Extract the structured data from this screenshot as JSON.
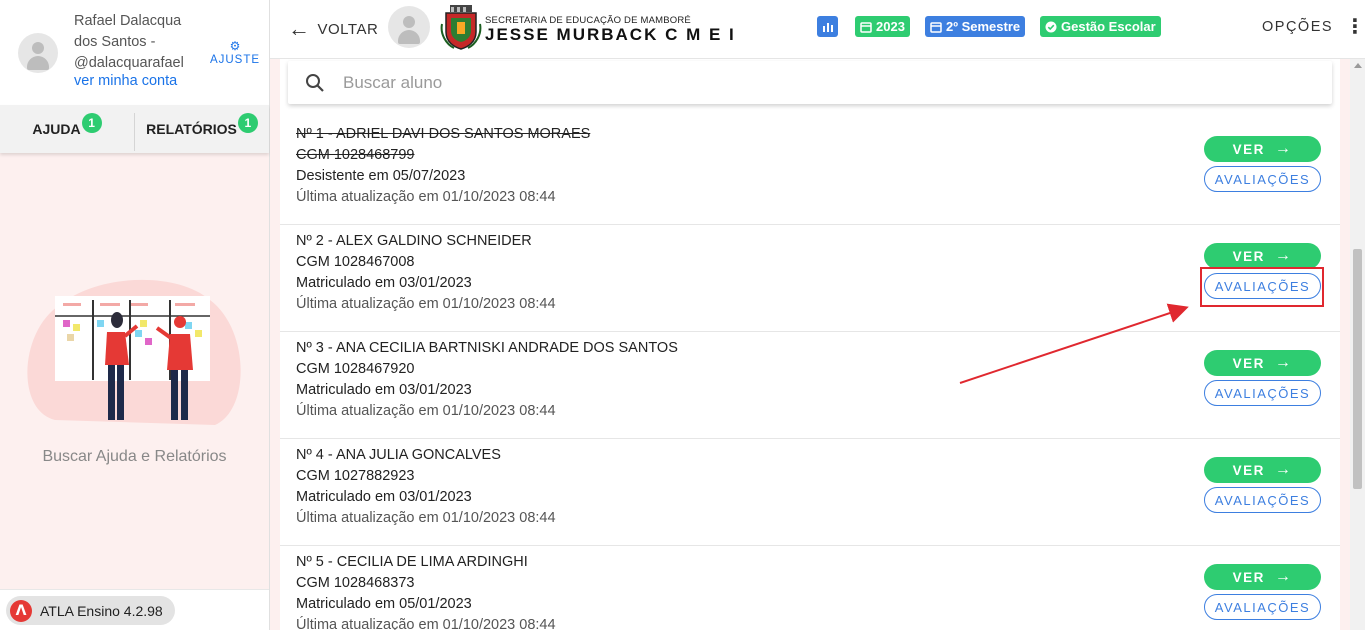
{
  "sidebar": {
    "user_name": "Rafael Dalacqua dos Santos - @dalacquarafael",
    "account_link": "ver minha conta",
    "adjust_label": "AJUSTE",
    "tabs": [
      {
        "label": "AJUDA",
        "badge": "1"
      },
      {
        "label": "RELATÓRIOS",
        "badge": "1"
      }
    ],
    "empty_text": "Buscar Ajuda e Relatórios",
    "version": "ATLA Ensino 4.2.98"
  },
  "header": {
    "back_label": "VOLTAR",
    "secretaria": "SECRETARIA DE EDUCAÇÃO DE MAMBORÉ",
    "school_name": "JESSE MURBACK C M E I",
    "pills": {
      "year": "2023",
      "semester": "2º Semestre",
      "gestao": "Gestão Escolar"
    },
    "options_label": "OPÇÕES",
    "colors": {
      "green": "#2ecc71",
      "blue": "#3d7fe0"
    }
  },
  "search": {
    "placeholder": "Buscar aluno",
    "value": ""
  },
  "students": [
    {
      "name": "Nº 1 - ADRIEL DAVI DOS SANTOS MORAES",
      "cgm": "CGM 1028468799",
      "status": "Desistente em 05/07/2023",
      "updated": "Última atualização em 01/10/2023 08:44",
      "struck": true
    },
    {
      "name": "Nº 2 - ALEX GALDINO SCHNEIDER",
      "cgm": "CGM 1028467008",
      "status": "Matriculado em 03/01/2023",
      "updated": "Última atualização em 01/10/2023 08:44",
      "struck": false,
      "highlighted": true
    },
    {
      "name": "Nº 3 - ANA CECILIA BARTNISKI ANDRADE DOS SANTOS",
      "cgm": "CGM 1028467920",
      "status": "Matriculado em 03/01/2023",
      "updated": "Última atualização em 01/10/2023 08:44",
      "struck": false
    },
    {
      "name": "Nº 4 - ANA JULIA GONCALVES",
      "cgm": "CGM 1027882923",
      "status": "Matriculado em 03/01/2023",
      "updated": "Última atualização em 01/10/2023 08:44",
      "struck": false
    },
    {
      "name": "Nº 5 - CECILIA DE LIMA ARDINGHI",
      "cgm": "CGM 1028468373",
      "status": "Matriculado em 05/01/2023",
      "updated": "Última atualização em 01/10/2023 08:44",
      "struck": false
    }
  ],
  "row_actions": {
    "ver_label": "VER",
    "avaliacoes_label": "AVALIAÇÕES"
  }
}
